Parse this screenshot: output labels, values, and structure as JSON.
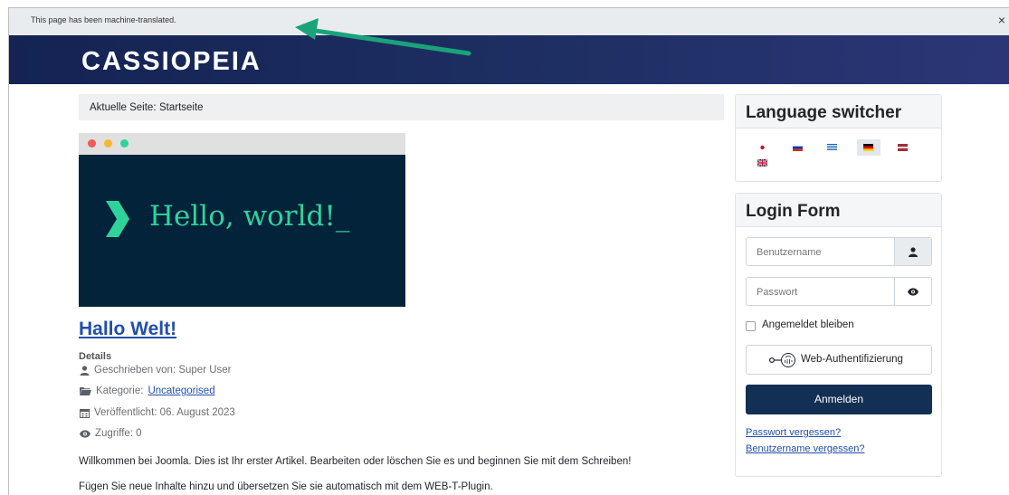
{
  "notice": {
    "text": "This page has been machine-translated.",
    "close": "×"
  },
  "header": {
    "brand": "CASSIOPEIA"
  },
  "breadcrumb": {
    "label": "Aktuelle Seite:",
    "current": "Startseite"
  },
  "hero_image": {
    "text": "Hello, world!_"
  },
  "article": {
    "title": "Hallo Welt!",
    "details_heading": "Details",
    "author": "Geschrieben von: Super User",
    "category_label": "Kategorie:",
    "category_link": "Uncategorised",
    "published": "Veröffentlicht: 06. August 2023",
    "hits": "Zugriffe: 0",
    "paragraphs": [
      "Willkommen bei Joomla. Dies ist Ihr erster Artikel. Bearbeiten oder löschen Sie es und beginnen Sie mit dem Schreiben!",
      "Fügen Sie neue Inhalte hinzu und übersetzen Sie sie automatisch mit dem WEB-T-Plugin."
    ]
  },
  "language_switcher": {
    "title": "Language switcher",
    "flags": [
      "japanese-flag-icon",
      "russian-flag-icon",
      "greek-flag-icon",
      "german-flag-icon",
      "latvian-flag-icon",
      "english-flag-icon"
    ],
    "active": "german-flag-icon"
  },
  "login": {
    "title": "Login Form",
    "username_placeholder": "Benutzername",
    "password_placeholder": "Passwort",
    "remember_label": "Angemeldet bleiben",
    "webauthn_label": "Web-Authentifizierung",
    "submit_label": "Anmelden",
    "forgot_password": "Passwort vergessen?",
    "forgot_username": "Benutzername vergessen?"
  },
  "colors": {
    "header": "#142353",
    "accent": "#132f53",
    "link": "#224faa",
    "hero_bg": "#03233b",
    "hero_text": "#2fd39a",
    "arrow": "#1aa37a"
  }
}
